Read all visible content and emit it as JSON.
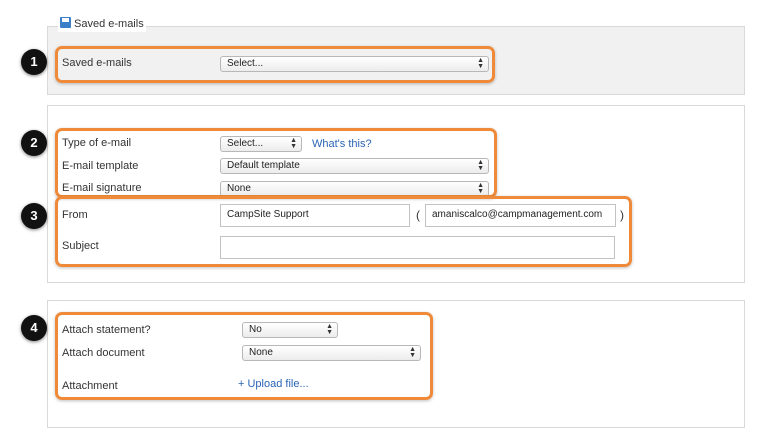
{
  "saved_section": {
    "legend": "Saved e-mails",
    "label": "Saved e-mails",
    "select_value": "Select..."
  },
  "email_settings": {
    "type_label": "Type of e-mail",
    "type_value": "Select...",
    "whats_this": "What's this?",
    "template_label": "E-mail template",
    "template_value": "Default template",
    "signature_label": "E-mail signature",
    "signature_value": "None",
    "from_label": "From",
    "from_name": "CampSite Support",
    "open_paren": "(",
    "from_email": "amaniscalco@campmanagement.com",
    "close_paren": ")",
    "subject_label": "Subject",
    "subject_value": ""
  },
  "attachments": {
    "statement_label": "Attach statement?",
    "statement_value": "No",
    "document_label": "Attach document",
    "document_value": "None",
    "attachment_label": "Attachment",
    "upload_link": "+ Upload file..."
  },
  "markers": [
    "1",
    "2",
    "3",
    "4"
  ],
  "colors": {
    "highlight": "#ee8a3a",
    "marker_bg": "#111111",
    "link": "#2a64b4",
    "panel_gray": "#f1f1f1"
  },
  "icons": [
    "save-icon",
    "chevron-updown-icon"
  ]
}
